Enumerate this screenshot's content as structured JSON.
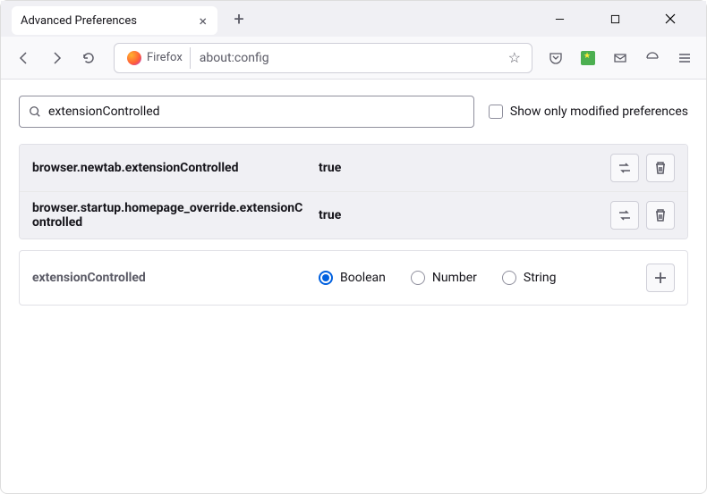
{
  "window": {
    "tab_title": "Advanced Preferences"
  },
  "urlbar": {
    "identity": "Firefox",
    "url": "about:config"
  },
  "search": {
    "value": "extensionControlled",
    "filter_label": "Show only modified preferences"
  },
  "prefs": [
    {
      "name": "browser.newtab.extensionControlled",
      "value": "true"
    },
    {
      "name": "browser.startup.homepage_override.extensionControlled",
      "value": "true"
    }
  ],
  "new_pref": {
    "name": "extensionControlled",
    "types": [
      "Boolean",
      "Number",
      "String"
    ],
    "selected": "Boolean"
  }
}
